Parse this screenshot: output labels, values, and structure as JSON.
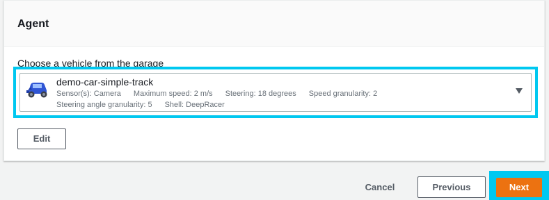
{
  "panel": {
    "title": "Agent"
  },
  "vehicle_field": {
    "label": "Choose a vehicle from the garage",
    "selected": {
      "name": "demo-car-simple-track",
      "sensors": "Sensor(s): Camera",
      "max_speed": "Maximum speed: 2 m/s",
      "steering": "Steering: 18 degrees",
      "speed_granularity": "Speed granularity: 2",
      "steering_granularity": "Steering angle granularity: 5",
      "shell": "Shell: DeepRacer"
    },
    "icon": "car-icon"
  },
  "buttons": {
    "edit": "Edit",
    "cancel": "Cancel",
    "previous": "Previous",
    "next": "Next"
  },
  "colors": {
    "highlight": "#00c8f0",
    "primary": "#ec7211",
    "text": "#16191f",
    "secondary_text": "#687078"
  }
}
